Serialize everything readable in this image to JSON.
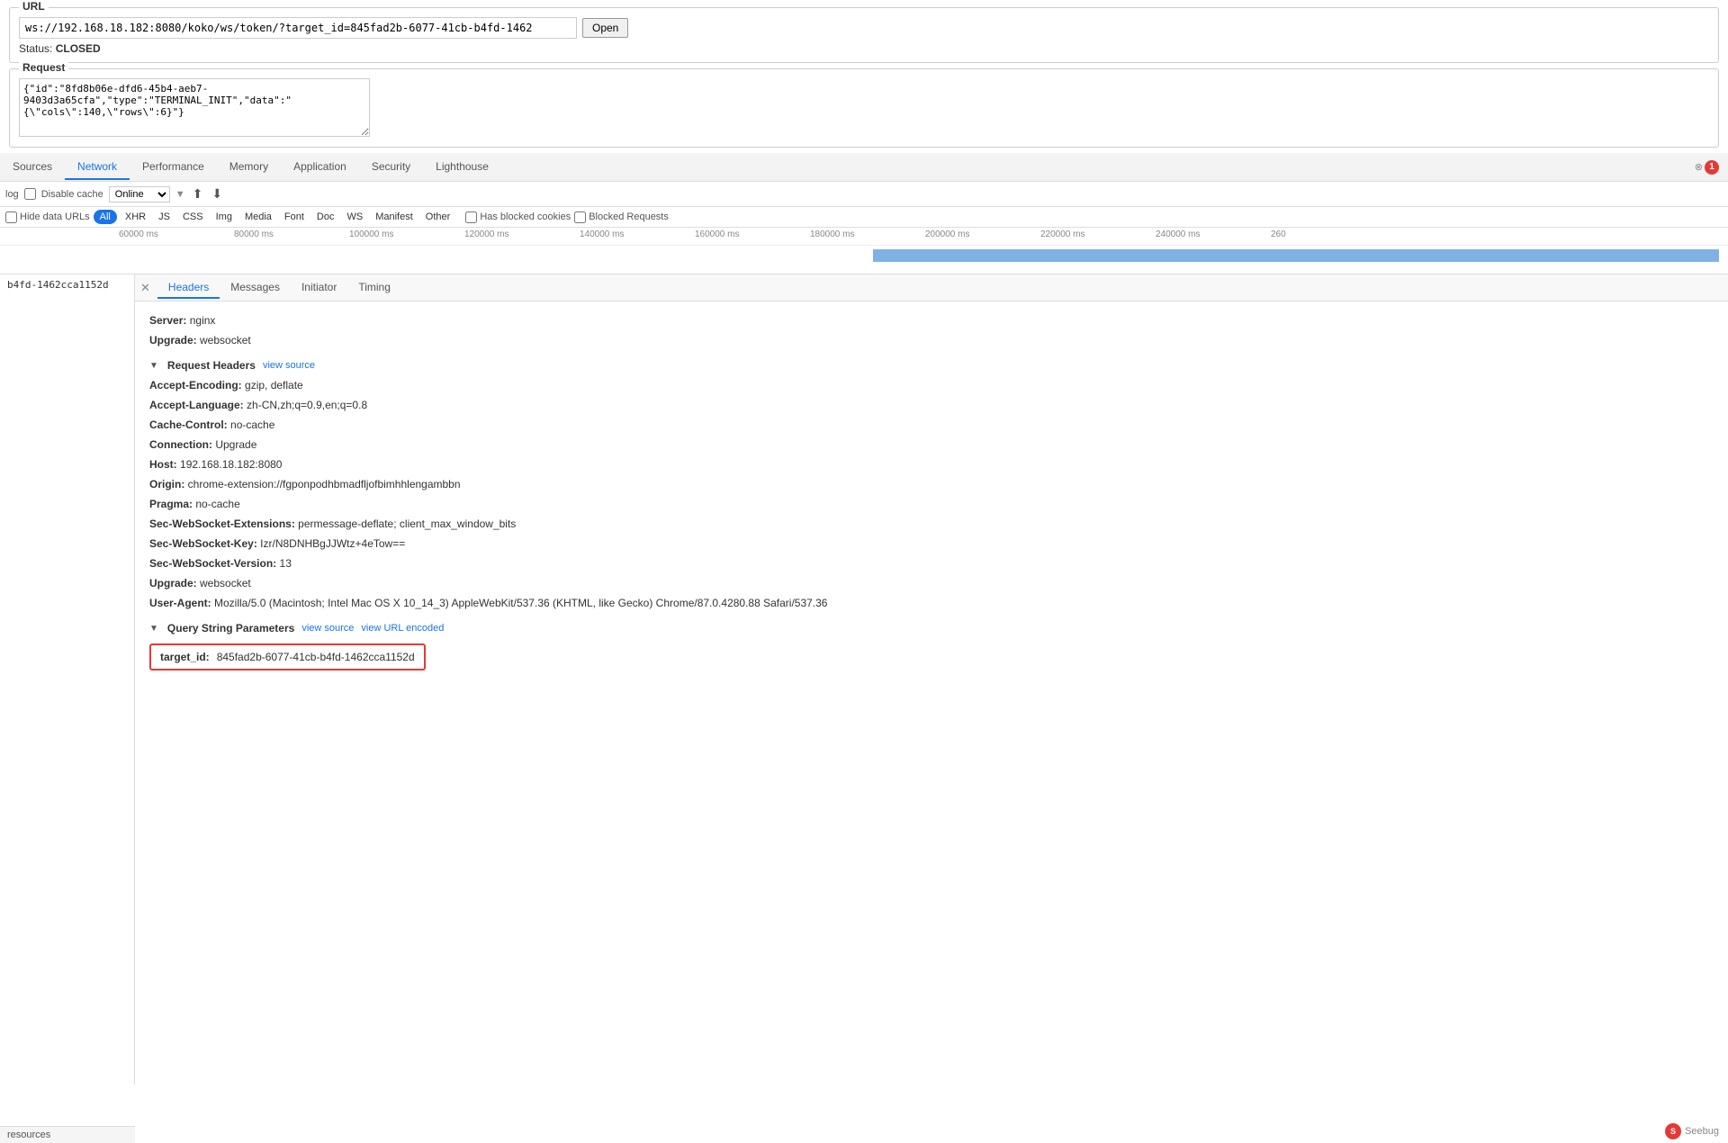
{
  "url_section": {
    "legend": "URL",
    "input_value": "ws://192.168.18.182:8080/koko/ws/token/?target_id=845fad2b-6077-41cb-b4fd-1462",
    "open_btn": "Open",
    "status_label": "Status:",
    "status_value": "CLOSED"
  },
  "request_section": {
    "legend": "Request",
    "textarea_value": "{\"id\":\"8fd8b06e-dfd6-45b4-aeb7-9403d3a65cfa\",\"type\":\"TERMINAL_INIT\",\"data\":\"{\\\"cols\\\":140,\\\"rows\\\":6}\"}"
  },
  "devtools_tabs": [
    {
      "id": "sources",
      "label": "Sources",
      "active": false
    },
    {
      "id": "network",
      "label": "Network",
      "active": true
    },
    {
      "id": "performance",
      "label": "Performance",
      "active": false
    },
    {
      "id": "memory",
      "label": "Memory",
      "active": false
    },
    {
      "id": "application",
      "label": "Application",
      "active": false
    },
    {
      "id": "security",
      "label": "Security",
      "active": false
    },
    {
      "id": "lighthouse",
      "label": "Lighthouse",
      "active": false
    }
  ],
  "error_badge": "1",
  "toolbar": {
    "log_label": "log",
    "disable_cache_label": "Disable cache",
    "online_label": "Online",
    "upload_icon": "⬆",
    "download_icon": "⬇"
  },
  "filter_row": {
    "hide_data_urls_label": "Hide data URLs",
    "all_btn": "All",
    "xhr_btn": "XHR",
    "js_btn": "JS",
    "css_btn": "CSS",
    "img_btn": "Img",
    "media_btn": "Media",
    "font_btn": "Font",
    "doc_btn": "Doc",
    "ws_btn": "WS",
    "manifest_btn": "Manifest",
    "other_btn": "Other",
    "has_blocked_cookies_label": "Has blocked cookies",
    "blocked_requests_label": "Blocked Requests"
  },
  "timeline": {
    "labels": [
      "60000 ms",
      "80000 ms",
      "100000 ms",
      "120000 ms",
      "140000 ms",
      "160000 ms",
      "180000 ms",
      "200000 ms",
      "220000 ms",
      "240000 ms",
      "260"
    ],
    "blue_bar_start_pct": 50.5,
    "blue_bar_width_pct": 49
  },
  "left_panel": {
    "item": "b4fd-1462cca1152d"
  },
  "sub_tabs": [
    {
      "id": "headers",
      "label": "Headers",
      "active": true
    },
    {
      "id": "messages",
      "label": "Messages",
      "active": false
    },
    {
      "id": "initiator",
      "label": "Initiator",
      "active": false
    },
    {
      "id": "timing",
      "label": "Timing",
      "active": false
    }
  ],
  "headers": {
    "response_headers": [
      {
        "key": "Server:",
        "value": "nginx"
      },
      {
        "key": "Upgrade:",
        "value": "websocket"
      }
    ],
    "request_headers_title": "Request Headers",
    "request_headers_view_source": "view source",
    "request_headers": [
      {
        "key": "Accept-Encoding:",
        "value": "gzip, deflate"
      },
      {
        "key": "Accept-Language:",
        "value": "zh-CN,zh;q=0.9,en;q=0.8"
      },
      {
        "key": "Cache-Control:",
        "value": "no-cache"
      },
      {
        "key": "Connection:",
        "value": "Upgrade"
      },
      {
        "key": "Host:",
        "value": "192.168.18.182:8080"
      },
      {
        "key": "Origin:",
        "value": "chrome-extension://fgponpodhbmadfljofbimhhlengambbn"
      },
      {
        "key": "Pragma:",
        "value": "no-cache"
      },
      {
        "key": "Sec-WebSocket-Extensions:",
        "value": "permessage-deflate; client_max_window_bits"
      },
      {
        "key": "Sec-WebSocket-Key:",
        "value": "Izr/N8DNHBgJJWtz+4eTow=="
      },
      {
        "key": "Sec-WebSocket-Version:",
        "value": "13"
      },
      {
        "key": "Upgrade:",
        "value": "websocket"
      },
      {
        "key": "User-Agent:",
        "value": "Mozilla/5.0 (Macintosh; Intel Mac OS X 10_14_3) AppleWebKit/537.36 (KHTML, like Gecko) Chrome/87.0.4280.88 Safari/537.36"
      }
    ],
    "query_params_title": "Query String Parameters",
    "query_params_view_source": "view source",
    "query_params_view_url_encoded": "view URL encoded",
    "query_params": [
      {
        "key": "target_id:",
        "value": "845fad2b-6077-41cb-b4fd-1462cca1152d"
      }
    ]
  },
  "bottom": {
    "resources_label": "resources"
  },
  "seebug": {
    "icon_label": "S",
    "text": "Seebug"
  }
}
